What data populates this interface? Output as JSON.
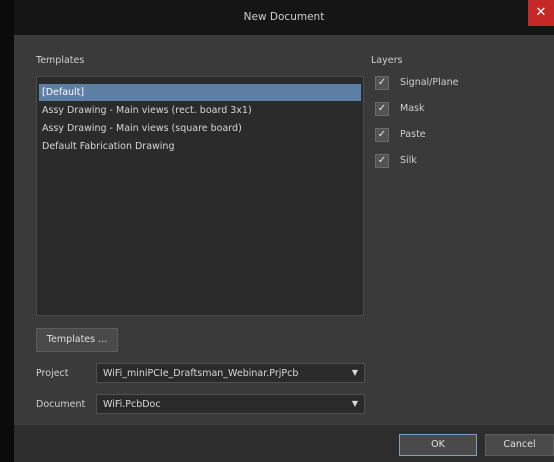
{
  "window": {
    "title": "New Document",
    "close_glyph": "✕"
  },
  "templates": {
    "heading": "Templates",
    "items": [
      {
        "label": "[Default]",
        "selected": true
      },
      {
        "label": "Assy Drawing - Main views (rect. board 3x1)",
        "selected": false
      },
      {
        "label": "Assy Drawing - Main views (square board)",
        "selected": false
      },
      {
        "label": "Default Fabrication Drawing",
        "selected": false
      }
    ],
    "button_label": "Templates ..."
  },
  "layers": {
    "heading": "Layers",
    "items": [
      {
        "label": "Signal/Plane",
        "checked": true
      },
      {
        "label": "Mask",
        "checked": true
      },
      {
        "label": "Paste",
        "checked": true
      },
      {
        "label": "Silk",
        "checked": true
      }
    ],
    "check_glyph": "✓"
  },
  "project": {
    "label": "Project",
    "value": "WiFi_miniPCIe_Draftsman_Webinar.PrjPcb"
  },
  "document": {
    "label": "Document",
    "value": "WiFi.PcbDoc"
  },
  "dropdown_glyph": "▼",
  "buttons": {
    "ok": "OK",
    "cancel": "Cancel"
  },
  "colors": {
    "selection": "#5d7ea5",
    "close": "#c62828",
    "primary_border": "#7a9ec6"
  }
}
